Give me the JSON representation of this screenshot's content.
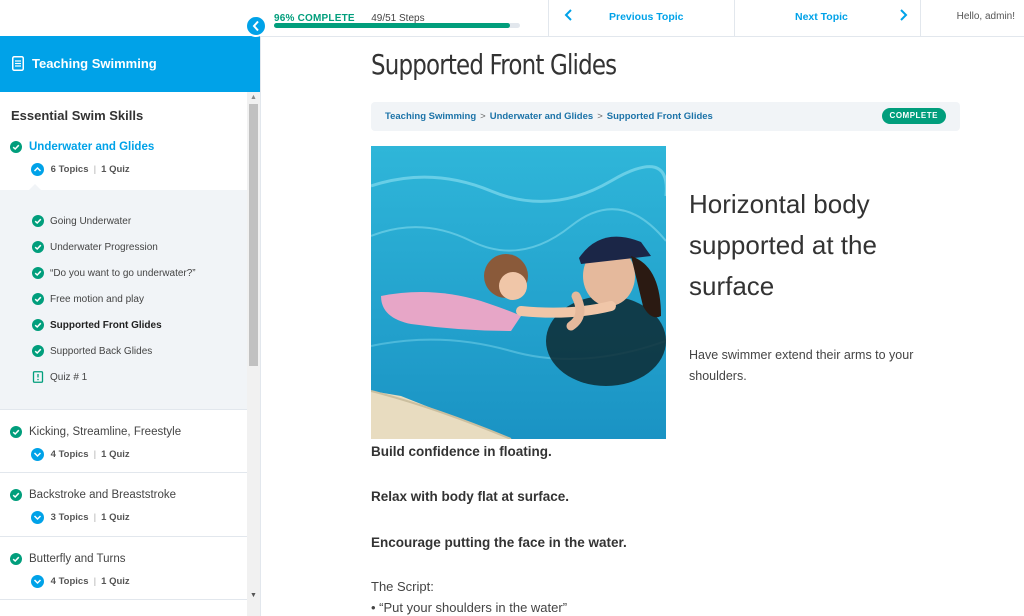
{
  "progress": {
    "percent_label": "96% COMPLETE",
    "steps_label": "49/51 Steps",
    "fraction": 0.96
  },
  "nav": {
    "prev_label": "Previous Topic",
    "next_label": "Next Topic",
    "greeting": "Hello, admin!"
  },
  "sidebar": {
    "course_title": "Teaching Swimming",
    "section_heading": "Essential Swim Skills",
    "lessons": [
      {
        "label": "Underwater and Glides",
        "topics": "6 Topics",
        "quiz": "1 Quiz",
        "expanded": true
      },
      {
        "label": "Kicking, Streamline, Freestyle",
        "topics": "4 Topics",
        "quiz": "1 Quiz",
        "expanded": false
      },
      {
        "label": "Backstroke and Breaststroke",
        "topics": "3 Topics",
        "quiz": "1 Quiz",
        "expanded": false
      },
      {
        "label": "Butterfly and Turns",
        "topics": "4 Topics",
        "quiz": "1 Quiz",
        "expanded": false
      }
    ],
    "topic_items": [
      {
        "label": "Going Underwater",
        "type": "topic"
      },
      {
        "label": "Underwater Progression",
        "type": "topic"
      },
      {
        "label": "“Do you want to go underwater?”",
        "type": "topic"
      },
      {
        "label": "Free motion and play",
        "type": "topic"
      },
      {
        "label": "Supported Front Glides",
        "type": "topic",
        "current": true
      },
      {
        "label": "Supported Back Glides",
        "type": "topic"
      },
      {
        "label": "Quiz # 1",
        "type": "quiz"
      }
    ]
  },
  "main": {
    "title": "Supported Front Glides",
    "breadcrumbs": [
      "Teaching Swimming",
      "Underwater and Glides",
      "Supported Front Glides"
    ],
    "status_badge": "COMPLETE",
    "side_heading": "Horizontal body supported at the surface",
    "side_paragraph": "Have swimmer extend their arms to your shoulders.",
    "bold_lines": [
      "Build confidence in floating.",
      "Relax with body flat at surface.",
      "Encourage putting the face in the water."
    ],
    "script_label": "The Script:",
    "script_bullet": "• “Put your shoulders in the water”"
  },
  "colors": {
    "accent": "#00a2e8",
    "complete": "#019e7c",
    "panel_bg": "#f1f4f7"
  },
  "icons": [
    "document-icon",
    "chevron-left-icon",
    "chevron-right-icon",
    "check-circle-icon",
    "chevron-up-icon",
    "chevron-down-icon",
    "quiz-icon"
  ]
}
